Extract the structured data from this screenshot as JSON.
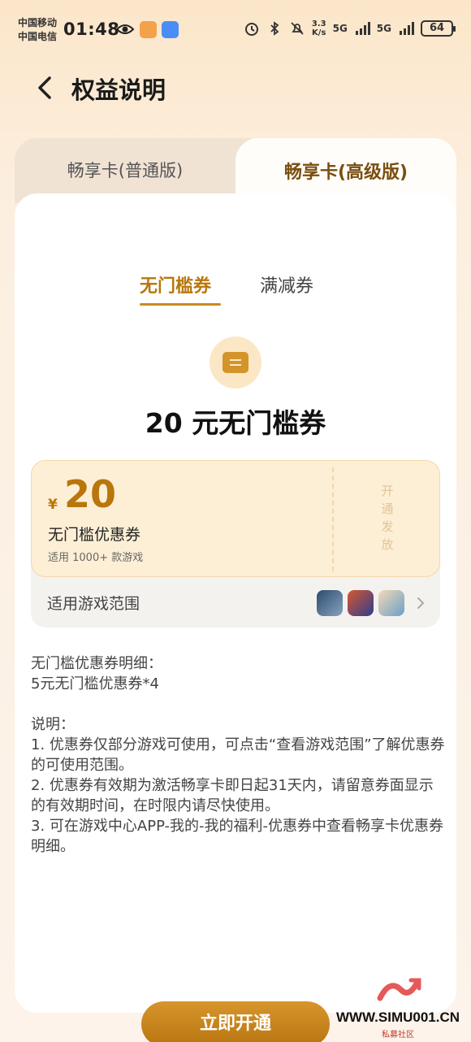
{
  "status_bar": {
    "carrier1": "中国移动",
    "carrier2": "中国电信",
    "time": "01:48",
    "net_speed_value": "3.3",
    "net_speed_unit": "K/s",
    "signal1": "5G",
    "signal2": "5G",
    "battery": "64"
  },
  "header": {
    "title": "权益说明"
  },
  "tabs": [
    {
      "label": "畅享卡(普通版)",
      "active": false
    },
    {
      "label": "畅享卡(高级版)",
      "active": true
    }
  ],
  "sub_tabs": [
    {
      "label": "无门槛券",
      "active": true
    },
    {
      "label": "满减券",
      "active": false
    }
  ],
  "coupon": {
    "heading": "20 元无门槛券",
    "currency": "¥",
    "amount": "20",
    "name": "无门槛优惠券",
    "description": "适用 1000+ 款游戏",
    "state": "开通发放",
    "range_label": "适用游戏范围"
  },
  "details": {
    "breakdown_title": "无门槛优惠券明细：",
    "breakdown_item": "5元无门槛优惠券*4",
    "notes_title": "说明：",
    "notes": [
      "1. 优惠券仅部分游戏可使用，可点击“查看游戏范围”了解优惠券的可使用范围。",
      "2. 优惠券有效期为激活畅享卡即日起31天内，请留意券面显示的有效期时间，在时限内请尽快使用。",
      "3. 可在游戏中心APP-我的-我的福利-优惠券中查看畅享卡优惠券明细。"
    ]
  },
  "cta": {
    "label": "立即开通"
  },
  "watermark": {
    "site": "WWW.SIMU001.CN",
    "sub": "私募社区"
  },
  "colors": {
    "accent": "#b8760d",
    "tab_active_text": "#7a4e10"
  }
}
